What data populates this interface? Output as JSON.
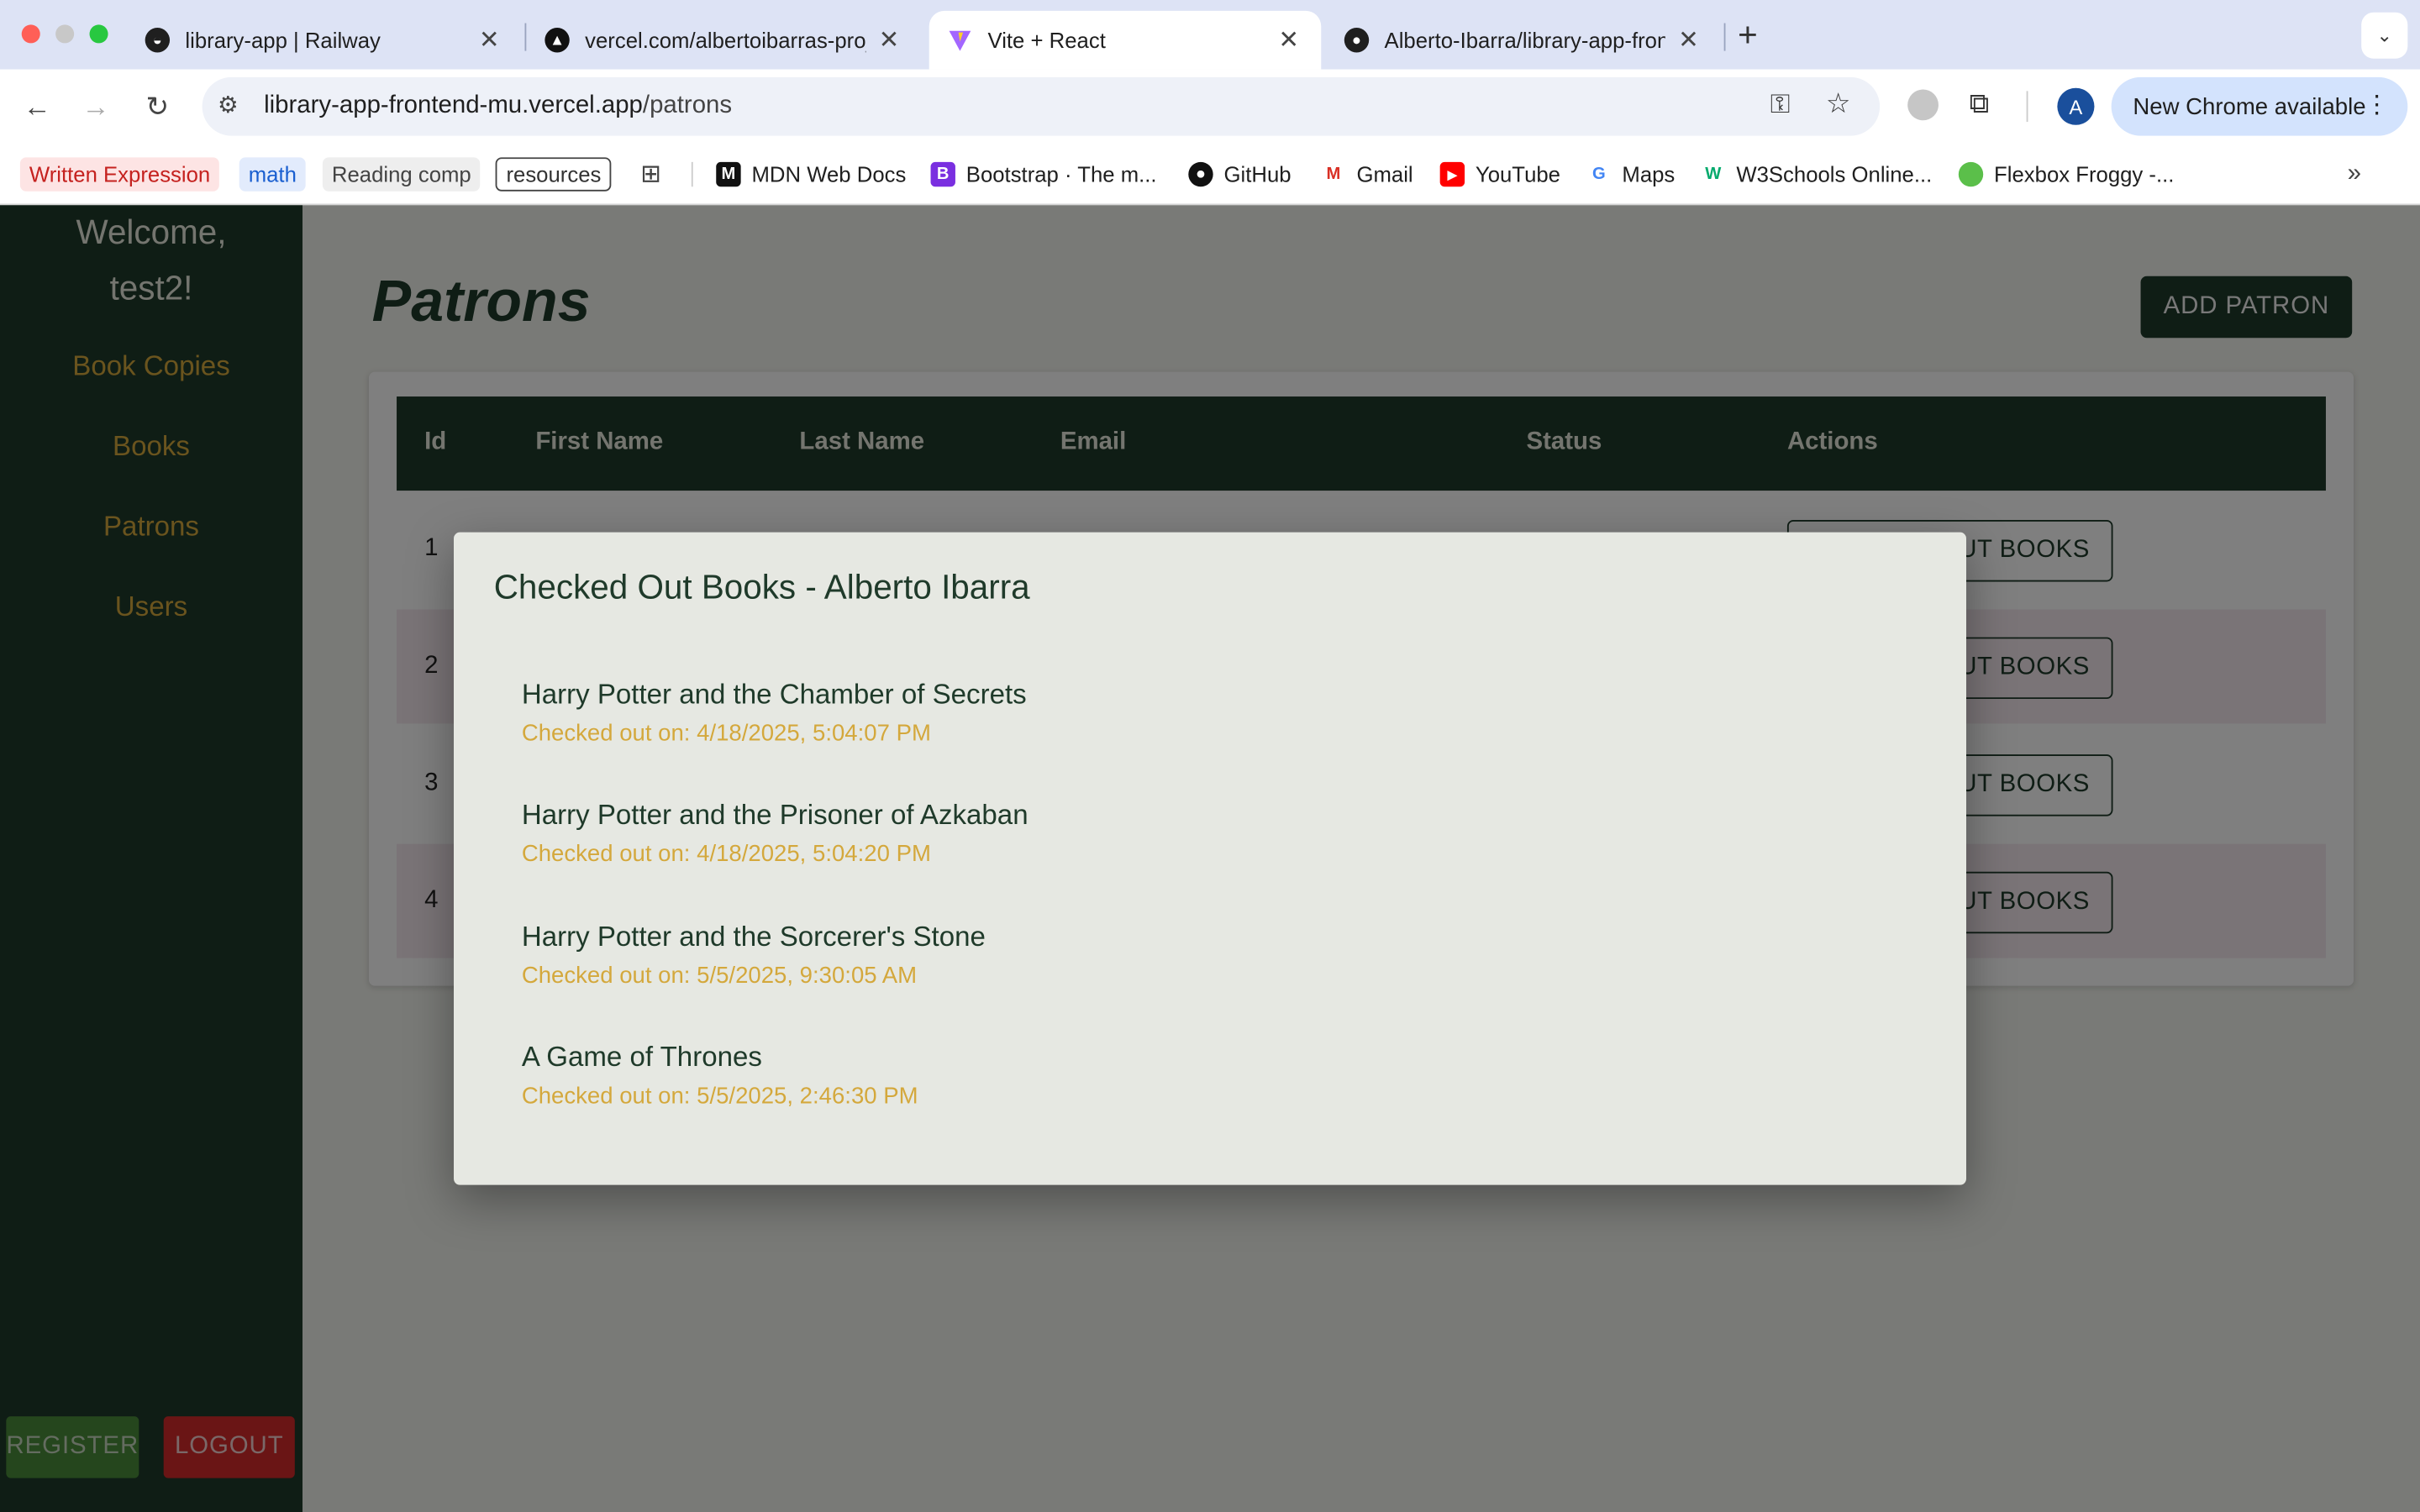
{
  "browser": {
    "tabs": [
      {
        "title": "library-app | Railway"
      },
      {
        "title": "vercel.com/albertoibarras-projects"
      },
      {
        "title": "Vite + React"
      },
      {
        "title": "Alberto-Ibarra/library-app-frontend"
      }
    ],
    "new_tab": "+",
    "url_host": "library-app-frontend-mu.vercel.app",
    "url_path": "/patrons",
    "new_chrome": "New Chrome available",
    "profile_initial": "A",
    "bookmarks": [
      {
        "label": "Written Expression"
      },
      {
        "label": "math"
      },
      {
        "label": "Reading comp"
      },
      {
        "label": "resources"
      },
      {
        "label": "MDN Web Docs"
      },
      {
        "label": "Bootstrap · The m..."
      },
      {
        "label": "GitHub"
      },
      {
        "label": "Gmail"
      },
      {
        "label": "YouTube"
      },
      {
        "label": "Maps"
      },
      {
        "label": "W3Schools Online..."
      },
      {
        "label": "Flexbox Froggy -..."
      }
    ],
    "more": "»"
  },
  "sidebar": {
    "welcome": "Welcome, test2!",
    "links": [
      {
        "label": "Book Copies"
      },
      {
        "label": "Books"
      },
      {
        "label": "Patrons"
      },
      {
        "label": "Users"
      }
    ],
    "register": "REGISTER",
    "logout": "LOGOUT"
  },
  "page": {
    "title": "Patrons",
    "add_button": "ADD PATRON",
    "headers": [
      "Id",
      "First Name",
      "Last Name",
      "Email",
      "Status",
      "Actions"
    ],
    "rows": [
      {
        "id": "1",
        "action": "UT BOOKS"
      },
      {
        "id": "2",
        "action": "UT BOOKS"
      },
      {
        "id": "3",
        "action": "UT BOOKS"
      },
      {
        "id": "4",
        "action": "UT BOOKS"
      }
    ]
  },
  "modal": {
    "title": "Checked Out Books - Alberto Ibarra",
    "books": [
      {
        "title": "Harry Potter and the Chamber of Secrets",
        "date": "Checked out on: 4/18/2025, 5:04:07 PM"
      },
      {
        "title": "Harry Potter and the Prisoner of Azkaban",
        "date": "Checked out on: 4/18/2025, 5:04:20 PM"
      },
      {
        "title": "Harry Potter and the Sorcerer's Stone",
        "date": "Checked out on: 5/5/2025, 9:30:05 AM"
      },
      {
        "title": "A Game of Thrones",
        "date": "Checked out on: 5/5/2025, 2:46:30 PM"
      }
    ]
  },
  "colors": {
    "sidebar_bg": "#1f3a2a",
    "accent_gold": "#d4a83c",
    "register_green": "#4a8c3a",
    "logout_red": "#d42a2a"
  }
}
